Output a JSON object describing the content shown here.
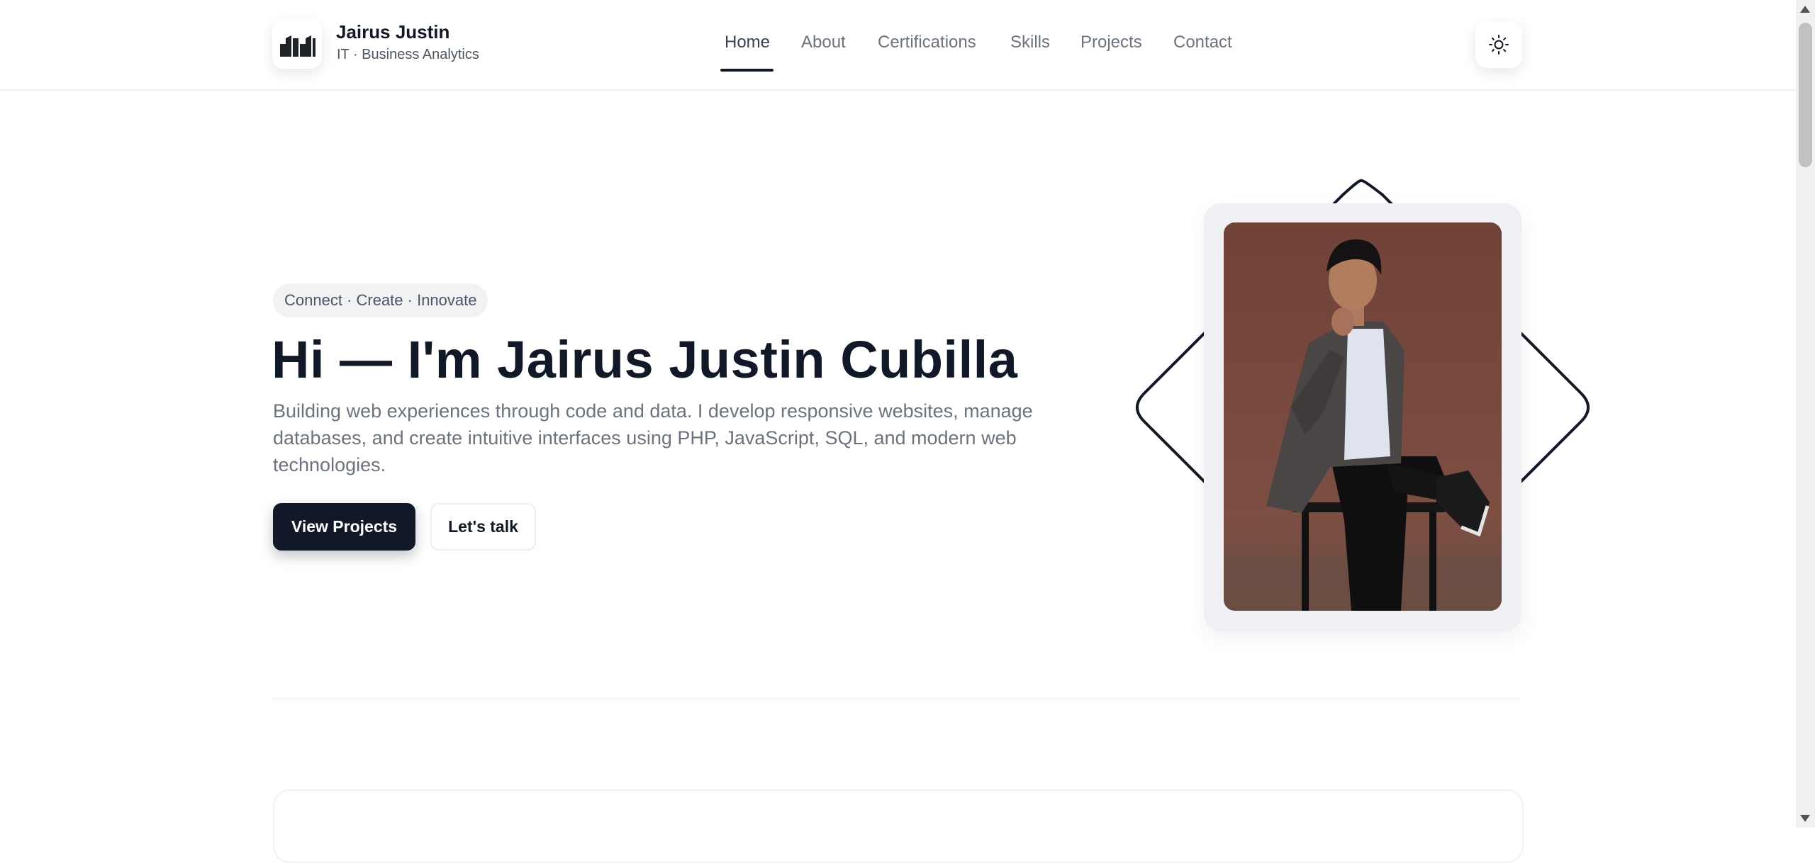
{
  "brand": {
    "name": "Jairus Justin",
    "subtitle": "IT · Business Analytics",
    "logo_icon": "jj-monogram-logo"
  },
  "nav": {
    "items": [
      {
        "label": "Home",
        "active": true
      },
      {
        "label": "About"
      },
      {
        "label": "Certifications"
      },
      {
        "label": "Skills"
      },
      {
        "label": "Projects"
      },
      {
        "label": "Contact"
      }
    ],
    "theme_toggle_icon": "sun-icon"
  },
  "hero": {
    "tagline": "Connect · Create · Innovate",
    "title": "Hi — I'm Jairus Justin Cubilla",
    "description": "Building web experiences through code and data. I develop responsive websites, manage databases, and create intuitive interfaces using PHP, JavaScript, SQL, and modern web technologies.",
    "primary_button": "View Projects",
    "secondary_button": "Let's talk"
  },
  "colors": {
    "accent": "#111827",
    "muted_text": "#6b7280",
    "photo_background": "#7a4a3e",
    "surface": "#eef0f4"
  }
}
